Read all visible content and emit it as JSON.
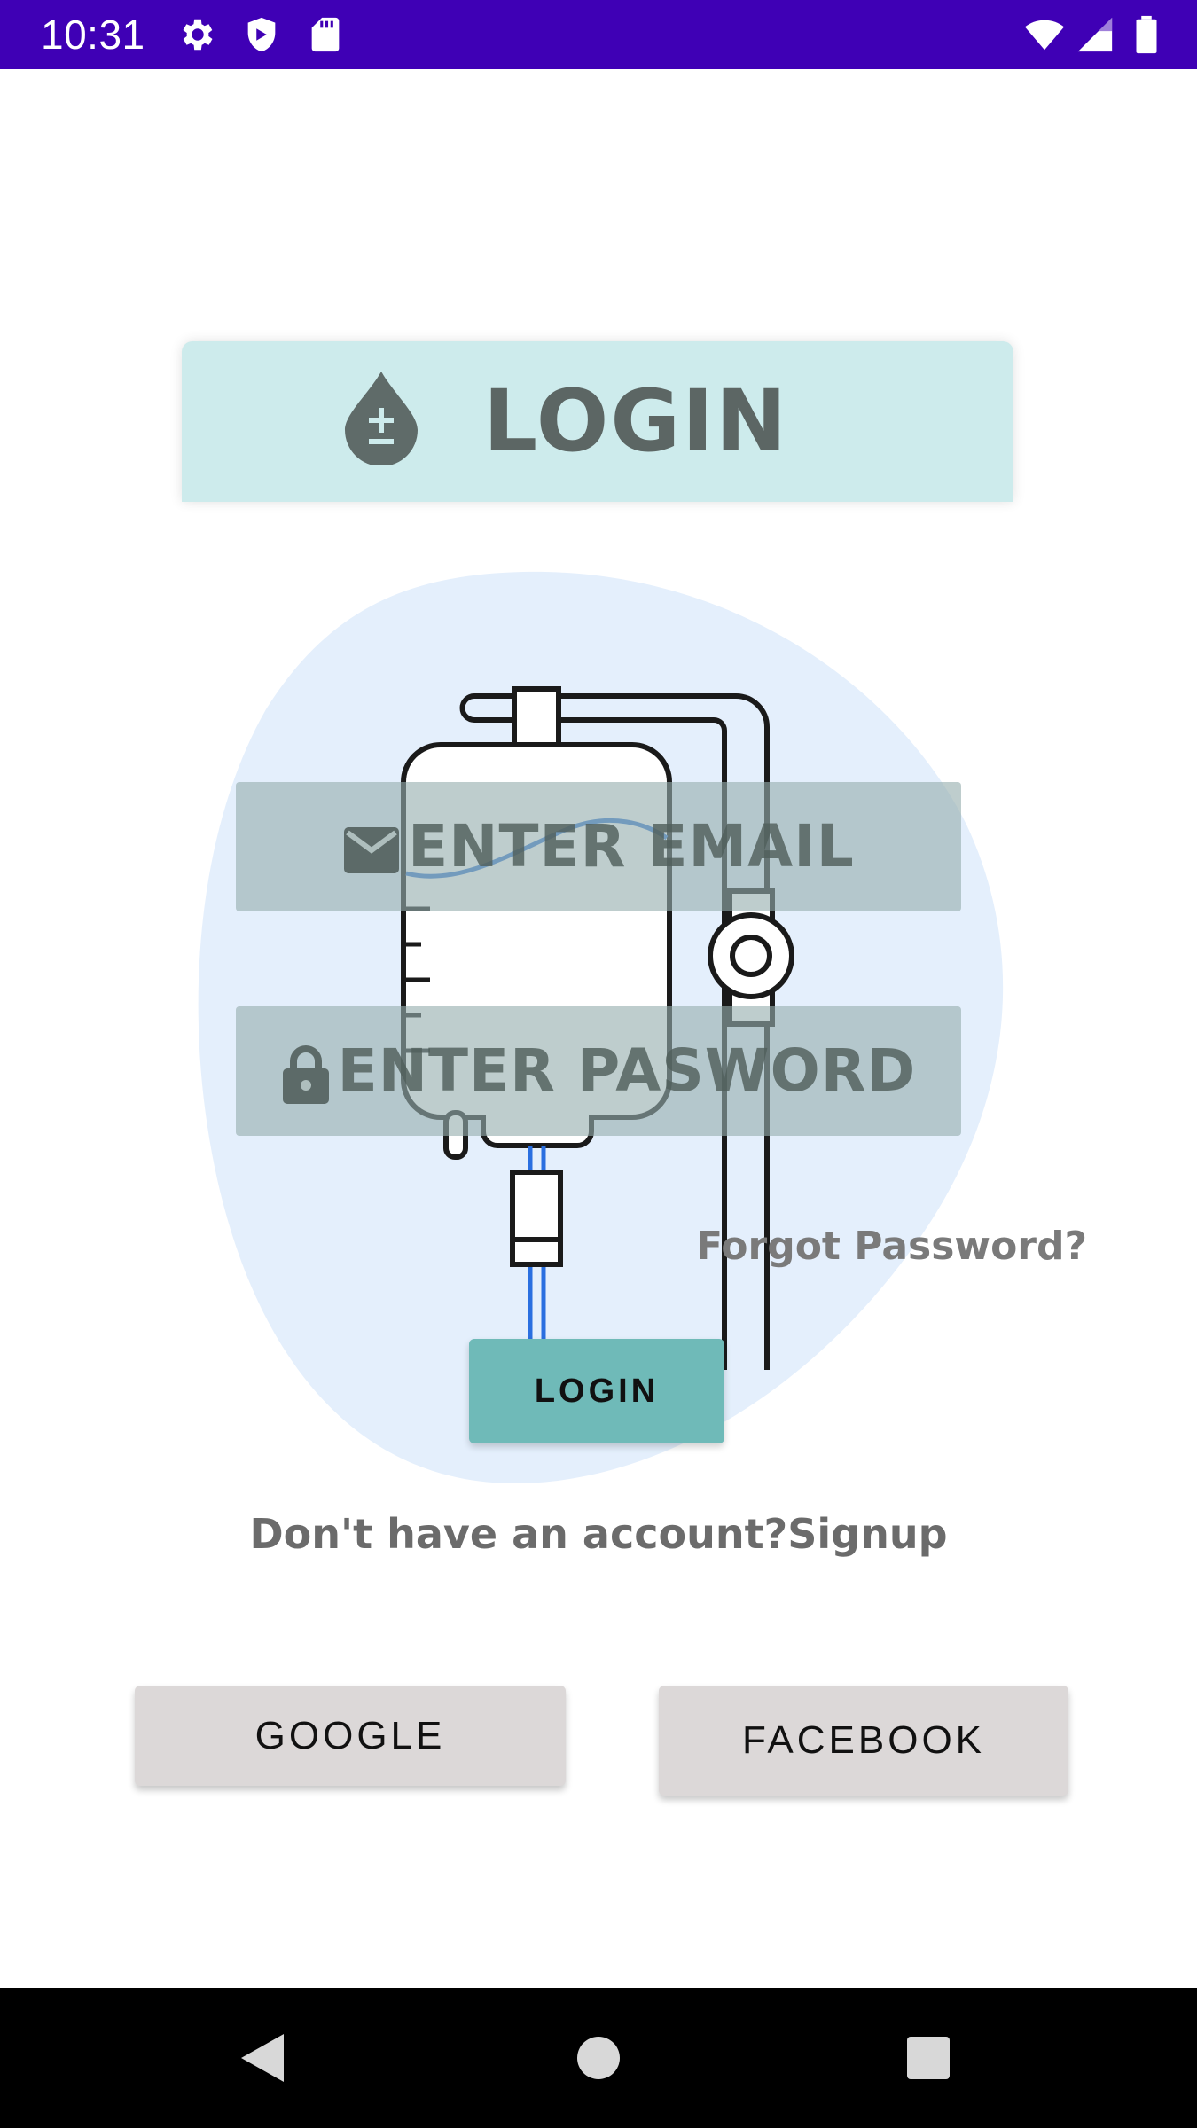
{
  "status_bar": {
    "time": "10:31",
    "icons_left": [
      "gear-icon",
      "shield-icon",
      "sd-card-icon"
    ],
    "icons_right": [
      "wifi-icon",
      "signal-icon",
      "battery-icon"
    ],
    "background": "#3f00b5"
  },
  "header": {
    "title": "LOGIN",
    "icon": "blood-drop-icon",
    "background": "#cdebec"
  },
  "form": {
    "email_placeholder": "ENTER EMAIL",
    "email_icon": "mail-icon",
    "password_placeholder": "ENTER PASWORD",
    "password_icon": "lock-icon",
    "forgot_password": "Forgot Password?",
    "login_button": "LOGIN",
    "login_button_color": "#6fbab8"
  },
  "signup": {
    "prefix": "Don't have an account?",
    "link": "Signup"
  },
  "social": {
    "google": "GOOGLE",
    "facebook": "FACEBOOK"
  },
  "nav_bar": {
    "buttons": [
      "back-icon",
      "home-icon",
      "recents-icon"
    ]
  }
}
